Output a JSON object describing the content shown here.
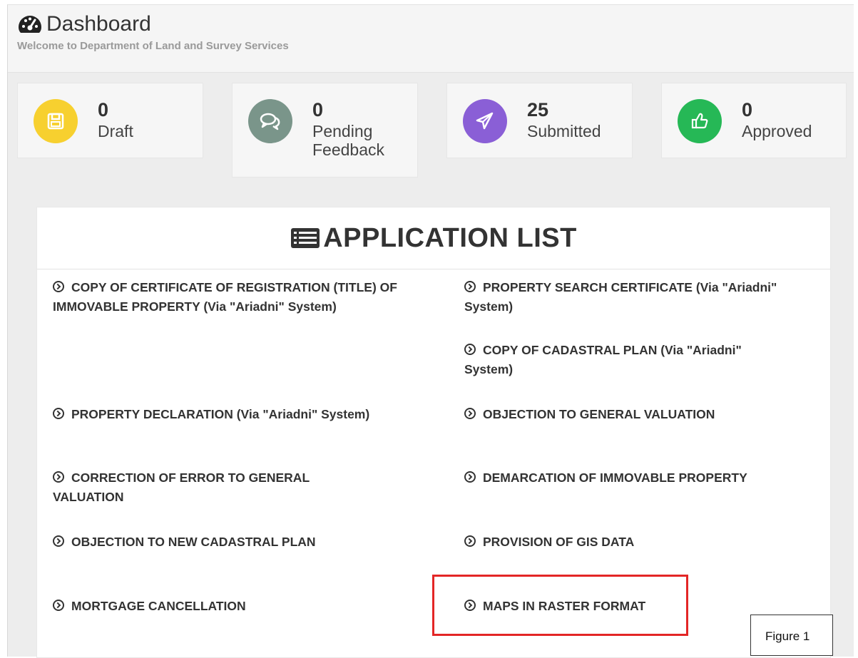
{
  "header": {
    "title": "Dashboard",
    "subtitle": "Welcome to Department of Land and Survey Services",
    "icon": "tachometer-icon"
  },
  "stats": [
    {
      "value": "0",
      "label": "Draft",
      "icon": "floppy-disk-icon",
      "color": "#f7d02f"
    },
    {
      "value": "0",
      "label_line1": "Pending",
      "label_line2": "Feedback",
      "icon": "comments-icon",
      "color": "#7a958a"
    },
    {
      "value": "25",
      "label": "Submitted",
      "icon": "paper-plane-icon",
      "color": "#8a5fd6"
    },
    {
      "value": "0",
      "label": "Approved",
      "icon": "thumbs-up-icon",
      "color": "#26b856"
    }
  ],
  "application_list": {
    "title": "APPLICATION LIST",
    "icon": "list-alt-icon",
    "left": [
      "COPY OF CERTIFICATE OF REGISTRATION (TITLE) OF IMMOVABLE PROPERTY (Via \"Ariadni\" System)",
      "PROPERTY DECLARATION (Via \"Ariadni\" System)",
      "CORRECTION OF ERROR TO GENERAL VALUATION",
      "OBJECTION TO NEW CADASTRAL PLAN",
      "MORTGAGE CANCELLATION"
    ],
    "right": [
      "PROPERTY SEARCH CERTIFICATE (Via \"Ariadni\" System)",
      "COPY OF CADASTRAL PLAN (Via \"Ariadni\" System)",
      "OBJECTION TO GENERAL VALUATION",
      "DEMARCATION OF IMMOVABLE PROPERTY",
      "PROVISION OF GIS DATA",
      "MAPS IN RASTER FORMAT"
    ]
  },
  "highlight_color": "#e32626",
  "figure_label": "Figure 1"
}
